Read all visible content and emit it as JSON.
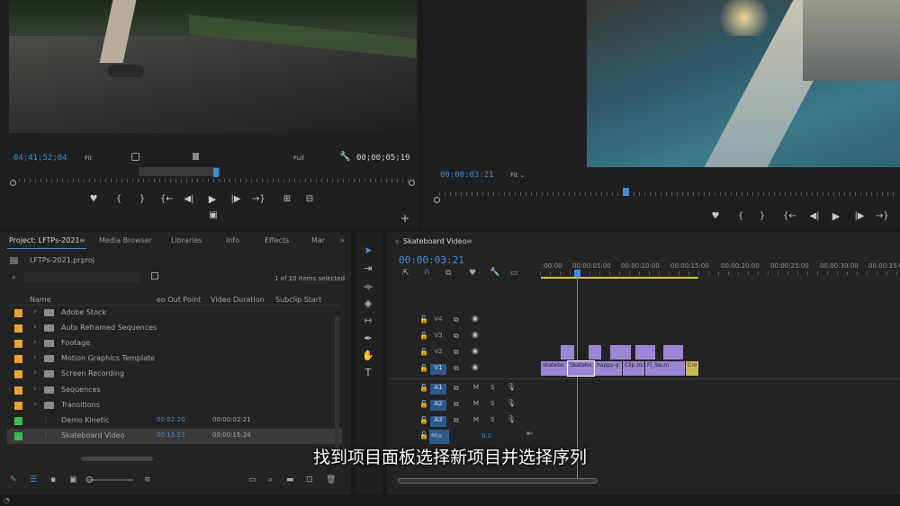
{
  "source_monitor": {
    "timecode": "04;41;52;04",
    "fit_label": "Fit",
    "full_label": "Full",
    "duration": "00;00;05;19"
  },
  "program_monitor": {
    "timecode": "00:00:03:21",
    "fit_label": "Fit"
  },
  "project_panel": {
    "tabs": [
      "Project: LFTPs-2021",
      "Media Browser",
      "Libraries",
      "Info",
      "Effects",
      "Mar"
    ],
    "more_tabs": "»",
    "file": "LFTPs-2021.prproj",
    "selection_status": "1 of 10 items selected",
    "columns": [
      "Name",
      "eo Out Point",
      "Video Duration",
      "Subclip Start"
    ],
    "items": [
      {
        "name": "Adobe Stock",
        "color": "#e8a23a",
        "type": "folder"
      },
      {
        "name": "Auto Reframed Sequences",
        "color": "#e8a23a",
        "type": "folder"
      },
      {
        "name": "Footage",
        "color": "#e8a23a",
        "type": "folder"
      },
      {
        "name": "Motion Graphics Template",
        "color": "#e8a23a",
        "type": "folder"
      },
      {
        "name": "Screen Recording",
        "color": "#e8a23a",
        "type": "folder"
      },
      {
        "name": "Sequences",
        "color": "#e8a23a",
        "type": "folder"
      },
      {
        "name": "Transitions",
        "color": "#e8a23a",
        "type": "folder"
      },
      {
        "name": "Demo Kinetic",
        "color": "#3cba54",
        "type": "sequence",
        "out": "00:02:20",
        "duration": "00:00:02:21"
      },
      {
        "name": "Skateboard Video",
        "color": "#3cba54",
        "type": "sequence",
        "out": "00:15:23",
        "duration": "00:00:15:24"
      }
    ]
  },
  "timeline": {
    "tab": "Skateboard Video",
    "timecode": "00:00:03:21",
    "ruler": [
      ":00:00",
      "00:00:05:00",
      "00:00:10:00",
      "00:00:15:00",
      "00:00:20:00",
      "00:00:25:00",
      "00:00:30:00",
      "00:00:35:0"
    ],
    "video_tracks": [
      "V4",
      "V3",
      "V2",
      "V1"
    ],
    "audio_tracks": [
      "A1",
      "A2",
      "A3"
    ],
    "mix_label": "Mix",
    "mix_value": "0.0",
    "clips_v1": [
      "skatebo",
      "Skatebo",
      "happy-g",
      "Clip.mc",
      "Fl_Sw.m",
      "Cro"
    ],
    "m_label": "M",
    "s_label": "S"
  },
  "subtitle": "找到项目面板选择新项目并选择序列",
  "colors": {
    "accent": "#3d8fdb",
    "clip": "#9b86d6",
    "folder": "#e8a23a",
    "sequence": "#3cba54"
  }
}
